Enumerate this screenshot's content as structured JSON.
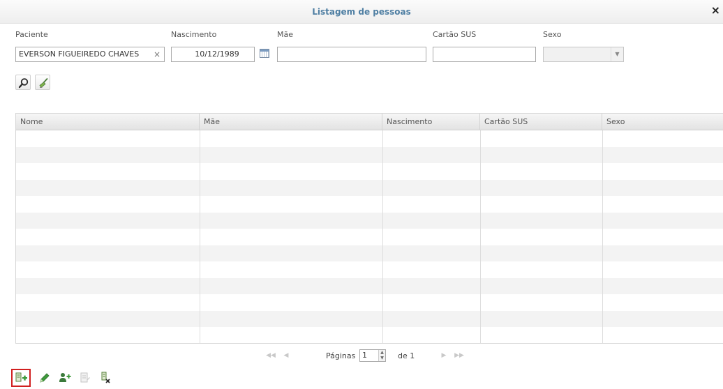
{
  "window": {
    "title": "Listagem de pessoas",
    "close_glyph": "×"
  },
  "filters": {
    "paciente": {
      "label": "Paciente",
      "value": "EVERSON FIGUEIREDO CHAVES",
      "clear_glyph": "×"
    },
    "nascimento": {
      "label": "Nascimento",
      "value": "10/12/1989"
    },
    "mae": {
      "label": "Mãe",
      "value": ""
    },
    "cartao_sus": {
      "label": "Cartão SUS",
      "value": ""
    },
    "sexo": {
      "label": "Sexo",
      "value": "",
      "arrow_glyph": "▼"
    }
  },
  "actions": {
    "search_icon": "search-icon",
    "clear_icon": "broom-icon"
  },
  "grid": {
    "columns": [
      "Nome",
      "Mãe",
      "Nascimento",
      "Cartão SUS",
      "Sexo"
    ],
    "rows": []
  },
  "pager": {
    "first": "◀◀",
    "prev": "◀",
    "label": "Páginas",
    "page": "1",
    "of_label": "de 1",
    "next": "▶",
    "last": "▶▶",
    "spin_up": "▲",
    "spin_down": "▼"
  },
  "bottom_toolbar": {
    "icons": [
      "add-record-icon",
      "edit-icon",
      "add-user-icon",
      "view-record-icon",
      "delete-record-icon"
    ]
  },
  "colors": {
    "title": "#4f7fa3",
    "highlight": "#d11f1f",
    "icon_green": "#3f9a3c"
  }
}
